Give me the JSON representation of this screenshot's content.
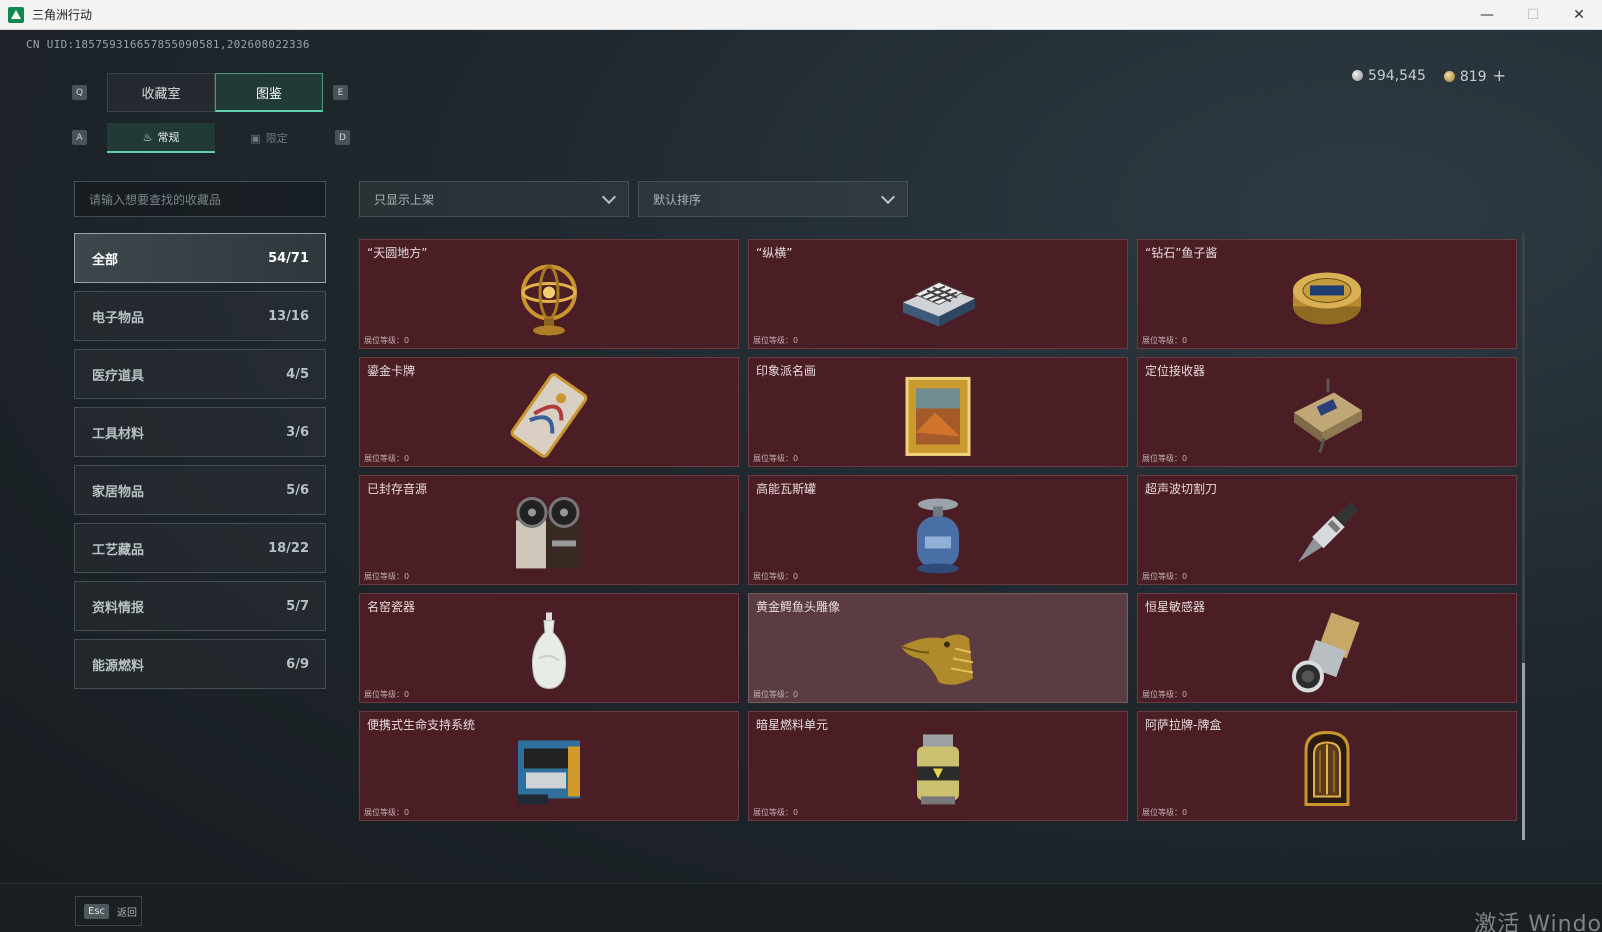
{
  "window": {
    "title": "三角洲行动",
    "controls": {
      "minimize": "—",
      "maximize": "☐",
      "close": "✕"
    }
  },
  "header": {
    "uid": "CN UID:185759316657855090581,202608022336",
    "silver": "594,545",
    "gold": "819",
    "plus": "+"
  },
  "keys": {
    "q": "Q",
    "e": "E",
    "a": "A",
    "d": "D"
  },
  "tabs": [
    {
      "label": "收藏室",
      "active": false
    },
    {
      "label": "图鉴",
      "active": true
    }
  ],
  "subtabs": [
    {
      "label": "常规",
      "icon": "flame-icon",
      "active": true
    },
    {
      "label": "限定",
      "icon": "image-icon",
      "active": false
    }
  ],
  "search": {
    "placeholder": "请输入想要查找的收藏品"
  },
  "filters": {
    "shelf": "只显示上架",
    "sort": "默认排序"
  },
  "categories": [
    {
      "name": "全部",
      "count": "54/71",
      "active": true
    },
    {
      "name": "电子物品",
      "count": "13/16"
    },
    {
      "name": "医疗道具",
      "count": "4/5"
    },
    {
      "name": "工具材料",
      "count": "3/6"
    },
    {
      "name": "家居物品",
      "count": "5/6"
    },
    {
      "name": "工艺藏品",
      "count": "18/22"
    },
    {
      "name": "资料情报",
      "count": "5/7"
    },
    {
      "name": "能源燃料",
      "count": "6/9"
    }
  ],
  "card_level_label": "展位等级：0",
  "items": [
    {
      "name": "",
      "icon": "partial-item-icon"
    },
    {
      "name": "",
      "icon": "partial-item-icon"
    },
    {
      "name": "",
      "icon": "partial-item-icon"
    },
    {
      "name": "“天圆地方”",
      "icon": "armillary-sphere-icon"
    },
    {
      "name": "“纵横”",
      "icon": "chess-box-icon"
    },
    {
      "name": "“钻石”鱼子酱",
      "icon": "caviar-tin-icon"
    },
    {
      "name": "鎏金卡牌",
      "icon": "gilded-card-icon"
    },
    {
      "name": "印象派名画",
      "icon": "framed-painting-icon"
    },
    {
      "name": "定位接收器",
      "icon": "gps-receiver-icon"
    },
    {
      "name": "已封存音源",
      "icon": "tape-recorder-icon"
    },
    {
      "name": "高能瓦斯罐",
      "icon": "gas-canister-icon"
    },
    {
      "name": "超声波切割刀",
      "icon": "ultrasonic-cutter-icon"
    },
    {
      "name": "名窑瓷器",
      "icon": "porcelain-vase-icon"
    },
    {
      "name": "黄金鳄鱼头雕像",
      "icon": "gold-crocodile-head-icon",
      "hover": true
    },
    {
      "name": "恒星敏感器",
      "icon": "star-sensor-icon"
    },
    {
      "name": "便携式生命支持系统",
      "icon": "life-support-icon"
    },
    {
      "name": "暗星燃料单元",
      "icon": "fuel-cell-icon"
    },
    {
      "name": "阿萨拉牌-牌盒",
      "icon": "card-case-icon"
    }
  ],
  "footer": {
    "esc_key": "Esc",
    "esc_label": "返回"
  },
  "watermark": "激活 Windo"
}
